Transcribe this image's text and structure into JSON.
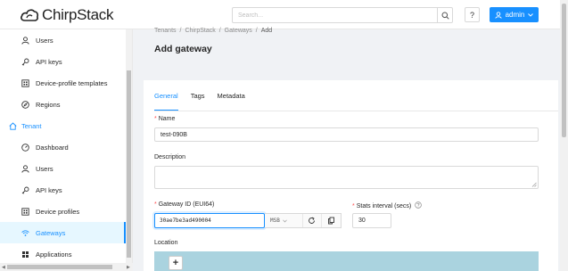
{
  "header": {
    "logo_text": "ChirpStack",
    "search_placeholder": "Search...",
    "help_label": "?",
    "user_label": "admin"
  },
  "sidebar": {
    "items": [
      {
        "label": "Users",
        "icon": "user-icon",
        "level": "sub"
      },
      {
        "label": "API keys",
        "icon": "key-icon",
        "level": "sub"
      },
      {
        "label": "Device-profile templates",
        "icon": "device-template-icon",
        "level": "sub"
      },
      {
        "label": "Regions",
        "icon": "compass-icon",
        "level": "sub"
      },
      {
        "label": "Tenant",
        "icon": "home-icon",
        "level": "top"
      },
      {
        "label": "Dashboard",
        "icon": "dashboard-icon",
        "level": "sub"
      },
      {
        "label": "Users",
        "icon": "user-icon",
        "level": "sub"
      },
      {
        "label": "API keys",
        "icon": "key-icon",
        "level": "sub"
      },
      {
        "label": "Device profiles",
        "icon": "device-profile-icon",
        "level": "sub"
      },
      {
        "label": "Gateways",
        "icon": "wifi-icon",
        "level": "sub",
        "active": true
      },
      {
        "label": "Applications",
        "icon": "applications-icon",
        "level": "sub"
      }
    ]
  },
  "breadcrumb": [
    "Tenants",
    "ChirpStack",
    "Gateways",
    "Add"
  ],
  "page_title": "Add gateway",
  "tabs": [
    {
      "label": "General",
      "active": true
    },
    {
      "label": "Tags",
      "active": false
    },
    {
      "label": "Metadata",
      "active": false
    }
  ],
  "form": {
    "name_label": "Name",
    "name_value": "test-090B",
    "description_label": "Description",
    "description_value": "",
    "gateway_id_label": "Gateway ID (EUI64)",
    "gateway_id_value": "30ae7be3ad490004",
    "byte_order": "MSB",
    "stats_label": "Stats interval (secs)",
    "stats_value": "30",
    "location_label": "Location",
    "zoom_in_label": "+"
  },
  "colors": {
    "accent": "#1890ff",
    "required": "#ff4d4f",
    "map_water": "#aad3df"
  }
}
